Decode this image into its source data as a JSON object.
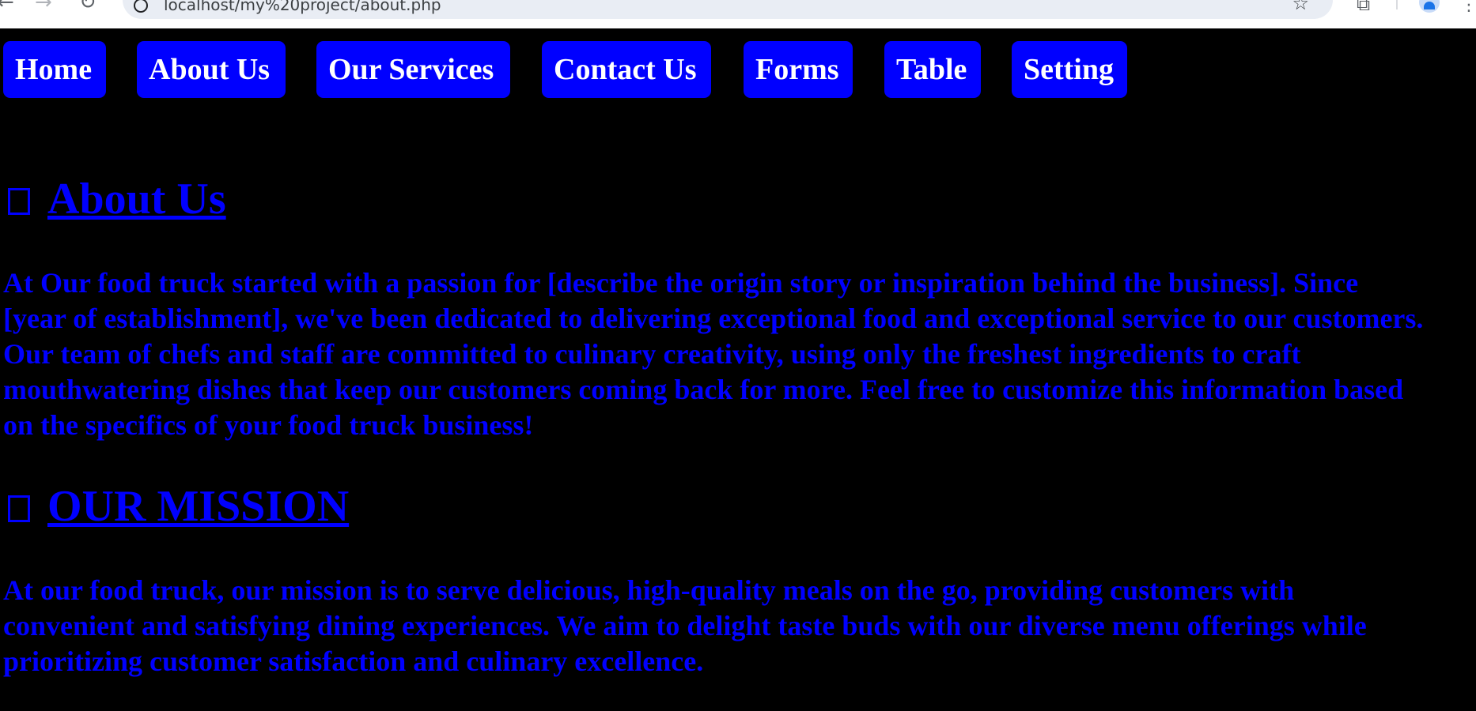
{
  "browser": {
    "url": "localhost/my%20project/about.php"
  },
  "nav": {
    "items": [
      {
        "label": "Home"
      },
      {
        "label": "About Us"
      },
      {
        "label": "Our Services"
      },
      {
        "label": "Contact Us"
      },
      {
        "label": "Forms"
      },
      {
        "label": "Table"
      },
      {
        "label": "Setting"
      }
    ]
  },
  "about": {
    "heading": "About Us",
    "body": "At Our food truck started with a passion for [describe the origin story or inspiration behind the business]. Since [year of establishment], we've been dedicated to delivering exceptional food and exceptional service to our customers. Our team of chefs and staff are committed to culinary creativity, using only the freshest ingredients to craft mouthwatering dishes that keep our customers coming back for more. Feel free to customize this information based on the specifics of your food truck business!"
  },
  "mission": {
    "heading": "OUR MISSION",
    "body": "At our food truck, our mission is to serve delicious, high-quality meals on the go, providing customers with convenient and satisfying dining experiences. We aim to delight taste buds with our diverse menu offerings while prioritizing customer satisfaction and culinary excellence."
  },
  "colors": {
    "page_background": "#000000",
    "accent_blue": "#0000ff",
    "button_text": "#ffffff"
  }
}
